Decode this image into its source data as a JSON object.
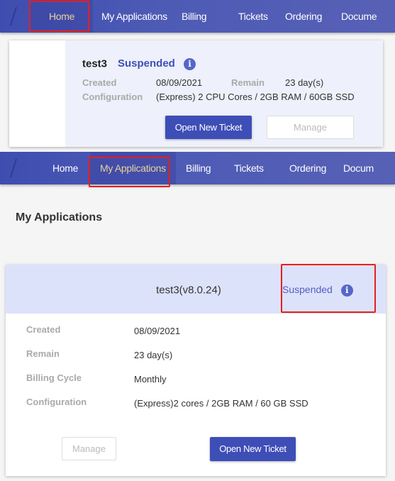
{
  "top_nav": {
    "items": [
      "Home",
      "My Applications",
      "Billing",
      "Tickets",
      "Ordering",
      "Docume"
    ],
    "active": "Home"
  },
  "home_card": {
    "name": "test3",
    "status": "Suspended",
    "status_icon": "info-icon",
    "created_label": "Created",
    "created_value": "08/09/2021",
    "remain_label": "Remain",
    "remain_value": "23 day(s)",
    "config_label": "Configuration",
    "config_value": "(Express) 2 CPU Cores / 2GB RAM / 60GB SSD",
    "open_ticket_label": "Open New Ticket",
    "manage_label": "Manage"
  },
  "second_nav": {
    "items": [
      "Home",
      "My Applications",
      "Billing",
      "Tickets",
      "Ordering",
      "Docum"
    ],
    "active": "My Applications"
  },
  "page_title": "My Applications",
  "app_card": {
    "title": "test3(v8.0.24)",
    "status": "Suspended",
    "status_icon": "info-icon",
    "rows": [
      {
        "label": "Created",
        "value": "08/09/2021"
      },
      {
        "label": "Remain",
        "value": "23 day(s)"
      },
      {
        "label": "Billing Cycle",
        "value": "Monthly"
      },
      {
        "label": "Configuration",
        "value": "(Express)2 cores / 2GB RAM / 60 GB SSD"
      }
    ],
    "manage_label": "Manage",
    "open_ticket_label": "Open New Ticket"
  },
  "colors": {
    "nav_bg": "#4d5bb5",
    "active_nav_text": "#e8d29a",
    "primary": "#3e4eb7",
    "highlight_box": "#e81e1e"
  }
}
